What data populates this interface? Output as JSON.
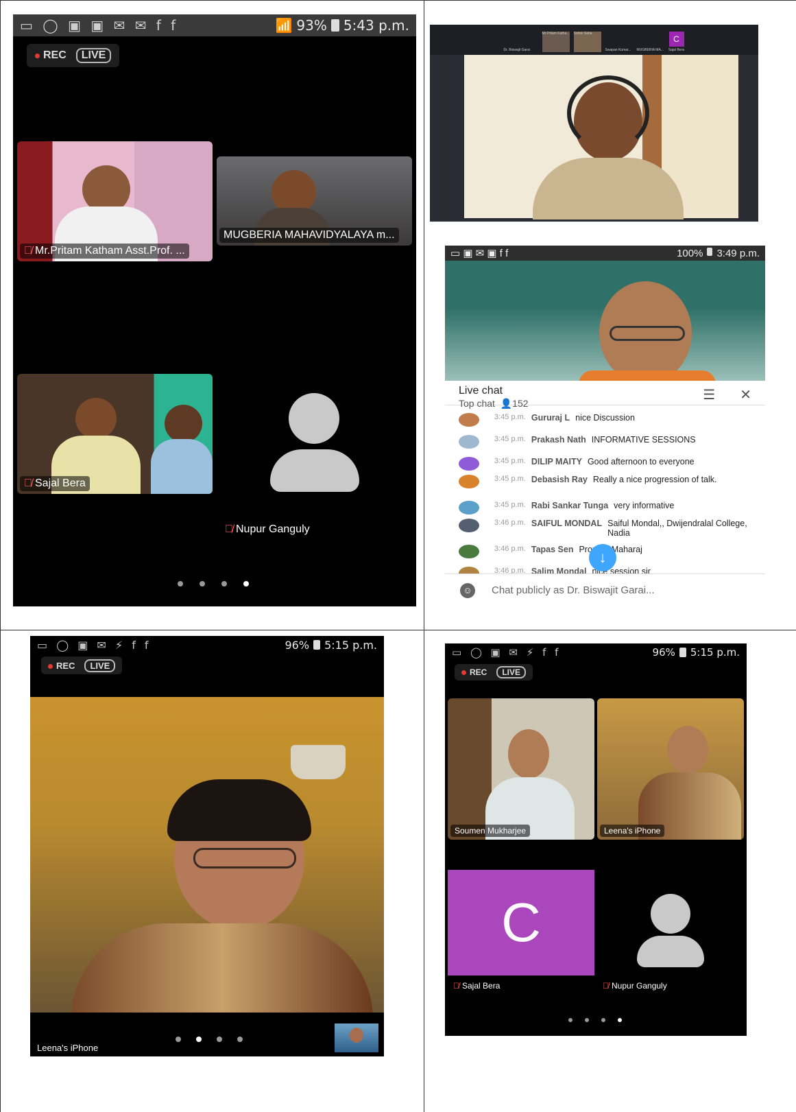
{
  "panels": {
    "top_left": {
      "status": {
        "battery": "93%",
        "time": "5:43 p.m."
      },
      "rec_label": "REC",
      "live_label": "LIVE",
      "tiles": [
        {
          "name": "Mr.Pritam Katham Asst.Prof. ..."
        },
        {
          "name": "MUGBERIA MAHAVIDYALAYA m..."
        },
        {
          "name": "Sajal Bera"
        },
        {
          "name": "Nupur Ganguly"
        }
      ]
    },
    "top_right": {
      "participants": [
        "Dr. Biswajit Garai",
        "Mr.Pritam Katha...",
        "Sohini Saha",
        "Swapan Kumar...",
        "MUGBERIA MA...",
        "Sajal Bera"
      ],
      "avatar_letter": "C"
    },
    "chat": {
      "status": {
        "battery": "100%",
        "time": "3:49 p.m."
      },
      "title": "Live chat",
      "subtitle": "Top chat",
      "viewers": "152",
      "messages": [
        {
          "time": "3:45 p.m.",
          "name": "Gururaj L",
          "text": "nice Discussion",
          "color": "#c27b4a"
        },
        {
          "time": "3:45 p.m.",
          "name": "Prakash Nath",
          "text": "INFORMATIVE SESSIONS",
          "color": "#9fb8cf"
        },
        {
          "time": "3:45 p.m.",
          "name": "DILIP MAITY",
          "text": "Good afternoon to everyone",
          "color": "#8e5ad6"
        },
        {
          "time": "3:45 p.m.",
          "name": "Debasish Ray",
          "text": "Really a nice progression of talk.",
          "color": "#d9822b"
        },
        {
          "time": "3:45 p.m.",
          "name": "Rabi Sankar Tunga",
          "text": "very informative",
          "color": "#5aa0c8"
        },
        {
          "time": "3:46 p.m.",
          "name": "SAIFUL MONDAL",
          "text": "Saiful Mondal,, Dwijendralal College, Nadia",
          "color": "#555f72"
        },
        {
          "time": "3:46 p.m.",
          "name": "Tapas Sen",
          "text": "Pronam Maharaj",
          "color": "#4a7a3d"
        },
        {
          "time": "3:46 p.m.",
          "name": "Salim Mondal",
          "text": "nice session sir",
          "color": "#b08440"
        }
      ],
      "input_placeholder": "Chat publicly as Dr. Biswajit Garai..."
    },
    "bottom_left": {
      "status": {
        "battery": "96%",
        "time": "5:15 p.m."
      },
      "rec_label": "REC",
      "live_label": "LIVE",
      "speaker_name": "Leena's iPhone"
    },
    "bottom_right": {
      "status": {
        "battery": "96%",
        "time": "5:15 p.m."
      },
      "rec_label": "REC",
      "live_label": "LIVE",
      "tiles": [
        {
          "name": "Soumen Mukharjee"
        },
        {
          "name": "Leena's iPhone"
        },
        {
          "name": "Sajal Bera",
          "letter": "C"
        },
        {
          "name": "Nupur Ganguly"
        }
      ]
    }
  }
}
